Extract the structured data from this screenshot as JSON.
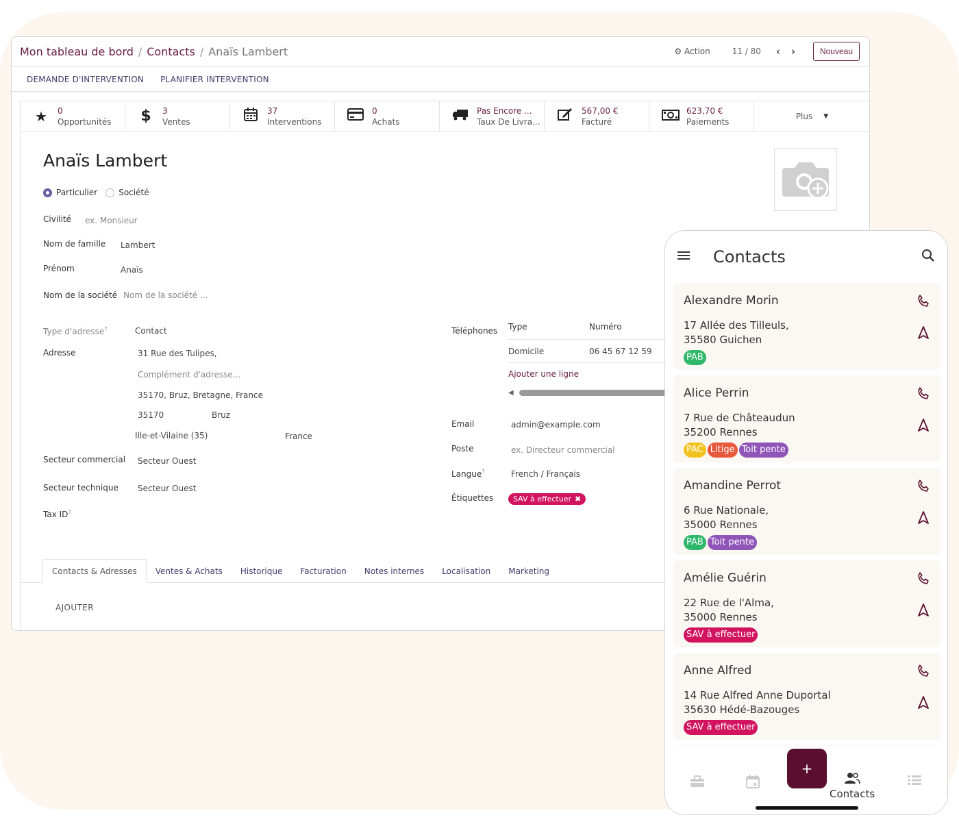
{
  "breadcrumb": {
    "root": "Mon tableau de bord",
    "parent": "Contacts",
    "current": "Anaïs Lambert",
    "sep": "/"
  },
  "toolbar": {
    "action": "Action",
    "pager": "11 / 80",
    "new_label": "Nouveau"
  },
  "actions": [
    "DEMANDE D'INTERVENTION",
    "PLANIFIER INTERVENTION"
  ],
  "stats": [
    {
      "icon": "star-icon",
      "value": "0",
      "label": "Opportunités"
    },
    {
      "icon": "dollar-icon",
      "value": "3",
      "label": "Ventes"
    },
    {
      "icon": "calendar-icon",
      "value": "37",
      "label": "Interventions"
    },
    {
      "icon": "credit-card-icon",
      "value": "0",
      "label": "Achats"
    },
    {
      "icon": "truck-icon",
      "value": "Pas Encore ...",
      "label": "Taux De Livra..."
    },
    {
      "icon": "edit-icon",
      "value": "567,00 €",
      "label": "Facturé"
    },
    {
      "icon": "money-icon",
      "value": "623,70 €",
      "label": "Paiements"
    }
  ],
  "stats_more": "Plus",
  "form": {
    "name": "Anaïs Lambert",
    "type_person": "Particulier",
    "type_company": "Société",
    "civility_label": "Civilité",
    "civility_placeholder": "ex. Monsieur",
    "lastname_label": "Nom de famille",
    "lastname_value": "Lambert",
    "firstname_label": "Prénom",
    "firstname_value": "Anaïs",
    "company_label": "Nom de la société",
    "company_placeholder": "Nom de la société ...",
    "address_type_label": "Type d'adresse",
    "address_type_value": "Contact",
    "address_label": "Adresse",
    "street": "31 Rue des Tulipes,",
    "street2_placeholder": "Complément d'adresse...",
    "full_address": "35170, Bruz, Bretagne, France",
    "zip": "35170",
    "city": "Bruz",
    "state": "Ille-et-Vilaine (35)",
    "country": "France",
    "sales_sector_label": "Secteur commercial",
    "sales_sector_value": "Secteur Ouest",
    "tech_sector_label": "Secteur technique",
    "tech_sector_value": "Secteur Ouest",
    "taxid_label": "Tax ID",
    "help_mark": "?",
    "phones_label": "Téléphones",
    "phones_col_type": "Type",
    "phones_col_number": "Numéro",
    "phone_type": "Domicile",
    "phone_number": "06 45 67 12 59",
    "add_line": "Ajouter une ligne",
    "email_label": "Email",
    "email_value": "admin@example.com",
    "position_label": "Poste",
    "position_placeholder": "ex. Directeur commercial",
    "lang_label": "Langue",
    "lang_value": "French / Français",
    "tags_label": "Étiquettes",
    "tag_value": "SAV à effectuer"
  },
  "tabs": [
    "Contacts & Adresses",
    "Ventes & Achats",
    "Historique",
    "Facturation",
    "Notes internes",
    "Localisation",
    "Marketing"
  ],
  "add_button": "AJOUTER",
  "mobile": {
    "title": "Contacts",
    "contacts": [
      {
        "name": "Alexandre Morin",
        "addr1": "17 Allée des Tilleuls,",
        "addr2": "35580 Guichen",
        "tags": [
          {
            "label": "PAB",
            "color": "#2fb86b"
          }
        ]
      },
      {
        "name": "Alice Perrin",
        "addr1": "7 Rue de Châteaudun",
        "addr2": "35200 Rennes",
        "tags": [
          {
            "label": "PAC",
            "color": "#f4c21c"
          },
          {
            "label": "Litige",
            "color": "#e8583b"
          },
          {
            "label": "Toit pente",
            "color": "#9055b8"
          }
        ]
      },
      {
        "name": "Amandine Perrot",
        "addr1": "6 Rue Nationale,",
        "addr2": "35000 Rennes",
        "tags": [
          {
            "label": "PAB",
            "color": "#2fb86b"
          },
          {
            "label": "Toit pente",
            "color": "#9055b8"
          }
        ]
      },
      {
        "name": "Amélie Guérin",
        "addr1": "22 Rue de l'Alma,",
        "addr2": "35000 Rennes",
        "tags": [
          {
            "label": "SAV à effectuer",
            "color": "#d2135f"
          }
        ]
      },
      {
        "name": "Anne Alfred",
        "addr1": "14 Rue Alfred Anne Duportal",
        "addr2": "35630 Hédé-Bazouges",
        "tags": [
          {
            "label": "SAV à effectuer",
            "color": "#d2135f"
          }
        ]
      }
    ],
    "fab_label": "+",
    "nav_contacts": "Contacts"
  },
  "colors": {
    "brand": "#6a1f3f",
    "fab": "#5a0f2e",
    "tag_sav": "#d2135f",
    "link": "#3c3c6c"
  }
}
